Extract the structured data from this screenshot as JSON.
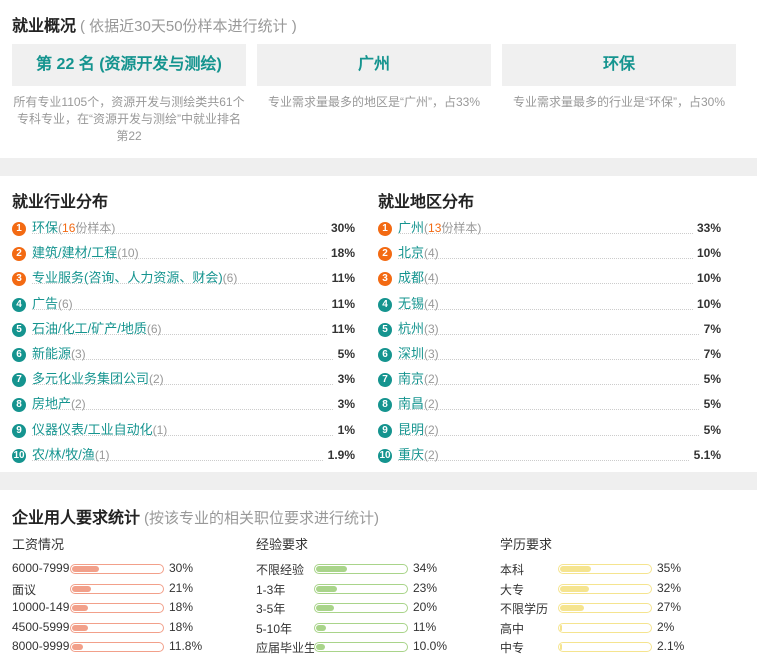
{
  "overview": {
    "title": "就业概况",
    "note": "( 依据近30天50份样本进行统计 )",
    "boxes": [
      {
        "label": "第 22 名 (资源开发与测绘)",
        "desc": "所有专业1105个，资源开发与测绘类共61个专科专业，在“资源开发与测绘”中就业排名第22"
      },
      {
        "label": "广州",
        "desc": "专业需求量最多的地区是“广州”，占33%"
      },
      {
        "label": "环保",
        "desc": "专业需求量最多的行业是“环保”，占30%"
      }
    ]
  },
  "industry": {
    "title": "就业行业分布",
    "items": [
      {
        "rank": "1",
        "name": "环保",
        "count_pre": "(",
        "count_num": "16",
        "count_post": "份样本)",
        "pct": "30%"
      },
      {
        "rank": "2",
        "name": "建筑/建材/工程",
        "count": "(10)",
        "pct": "18%"
      },
      {
        "rank": "3",
        "name": "专业服务(咨询、人力资源、财会)",
        "count": "(6)",
        "pct": "11%"
      },
      {
        "rank": "4",
        "name": "广告",
        "count": "(6)",
        "pct": "11%"
      },
      {
        "rank": "5",
        "name": "石油/化工/矿产/地质",
        "count": "(6)",
        "pct": "11%"
      },
      {
        "rank": "6",
        "name": "新能源",
        "count": "(3)",
        "pct": "5%"
      },
      {
        "rank": "7",
        "name": "多元化业务集团公司",
        "count": "(2)",
        "pct": "3%"
      },
      {
        "rank": "8",
        "name": "房地产",
        "count": "(2)",
        "pct": "3%"
      },
      {
        "rank": "9",
        "name": "仪器仪表/工业自动化",
        "count": "(1)",
        "pct": "1%"
      },
      {
        "rank": "10",
        "name": "农/林/牧/渔",
        "count": "(1)",
        "pct": "1.9%"
      }
    ]
  },
  "region": {
    "title": "就业地区分布",
    "items": [
      {
        "rank": "1",
        "name": "广州",
        "count_pre": "(",
        "count_num": "13",
        "count_post": "份样本)",
        "pct": "33%"
      },
      {
        "rank": "2",
        "name": "北京",
        "count": "(4)",
        "pct": "10%"
      },
      {
        "rank": "3",
        "name": "成都",
        "count": "(4)",
        "pct": "10%"
      },
      {
        "rank": "4",
        "name": "无锡",
        "count": "(4)",
        "pct": "10%"
      },
      {
        "rank": "5",
        "name": "杭州",
        "count": "(3)",
        "pct": "7%"
      },
      {
        "rank": "6",
        "name": "深圳",
        "count": "(3)",
        "pct": "7%"
      },
      {
        "rank": "7",
        "name": "南京",
        "count": "(2)",
        "pct": "5%"
      },
      {
        "rank": "8",
        "name": "南昌",
        "count": "(2)",
        "pct": "5%"
      },
      {
        "rank": "9",
        "name": "昆明",
        "count": "(2)",
        "pct": "5%"
      },
      {
        "rank": "10",
        "name": "重庆",
        "count": "(2)",
        "pct": "5.1%"
      }
    ]
  },
  "requirements": {
    "title": "企业用人要求统计",
    "note": "(按该专业的相关职位要求进行统计)",
    "salary": {
      "title": "工资情况",
      "items": [
        {
          "label": "6000-7999",
          "pct": "30%",
          "level": 0.3
        },
        {
          "label": "面议",
          "pct": "21%",
          "level": 0.21
        },
        {
          "label": "10000-149",
          "pct": "18%",
          "level": 0.18
        },
        {
          "label": "4500-5999",
          "pct": "18%",
          "level": 0.18
        },
        {
          "label": "8000-9999",
          "pct": "11.8%",
          "level": 0.118
        }
      ]
    },
    "experience": {
      "title": "经验要求",
      "items": [
        {
          "label": "不限经验",
          "pct": "34%",
          "level": 0.34
        },
        {
          "label": "1-3年",
          "pct": "23%",
          "level": 0.23
        },
        {
          "label": "3-5年",
          "pct": "20%",
          "level": 0.2
        },
        {
          "label": "5-10年",
          "pct": "11%",
          "level": 0.11
        },
        {
          "label": "应届毕业生",
          "pct": "10.0%",
          "level": 0.1
        }
      ]
    },
    "education": {
      "title": "学历要求",
      "items": [
        {
          "label": "本科",
          "pct": "35%",
          "level": 0.35
        },
        {
          "label": "大专",
          "pct": "32%",
          "level": 0.32
        },
        {
          "label": "不限学历",
          "pct": "27%",
          "level": 0.27
        },
        {
          "label": "高中",
          "pct": "2%",
          "level": 0.02
        },
        {
          "label": "中专",
          "pct": "2.1%",
          "level": 0.021
        }
      ]
    }
  },
  "colors": {
    "teal": "#15948f",
    "orange": "#f36a13",
    "salary_bar": "#f2a08a",
    "experience_bar": "#a9d48a",
    "education_bar": "#f5e48f"
  }
}
